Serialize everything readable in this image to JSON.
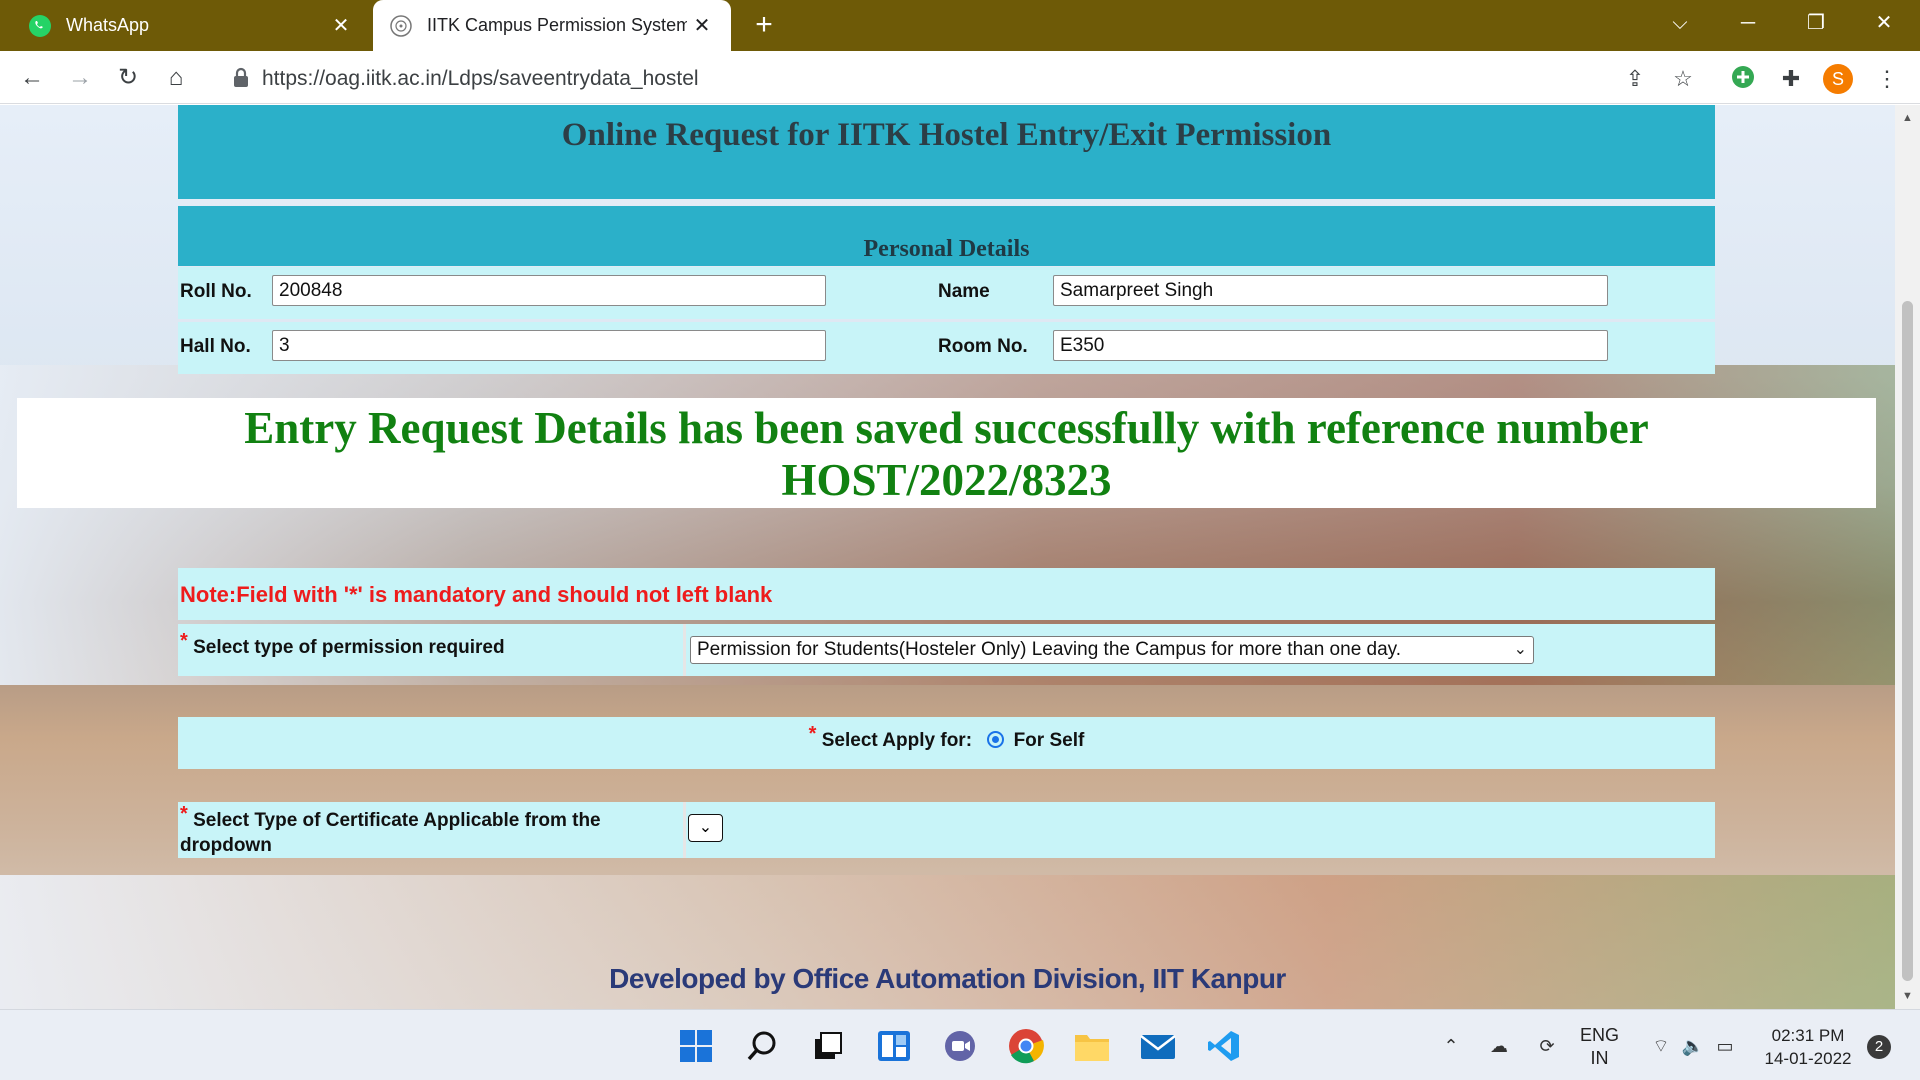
{
  "browser": {
    "tabs": [
      {
        "label": "WhatsApp",
        "icon": "whatsapp-icon",
        "active": false
      },
      {
        "label": "IITK Campus Permission System",
        "icon": "iitk-logo-icon",
        "active": true
      }
    ],
    "url": "https://oag.iitk.ac.in/Ldps/saveentrydata_hostel",
    "profile_initial": "S"
  },
  "page": {
    "title": "Online Request for IITK Hostel Entry/Exit Permission",
    "personal_details_title": "Personal Details",
    "fields": {
      "roll_label": "Roll No.",
      "roll_value": "200848",
      "name_label": "Name",
      "name_value": "Samarpreet Singh",
      "hall_label": "Hall No.",
      "hall_value": "3",
      "room_label": "Room No.",
      "room_value": "E350"
    },
    "success_line1": "Entry Request Details has been saved successfully with reference number",
    "success_line2": "HOST/2022/8323",
    "note": "Note:Field with '*' is mandatory and should not left blank",
    "required_mark": "*",
    "permission_label": "Select type of permission required",
    "permission_value": "Permission for Students(Hosteler Only) Leaving the Campus for more than one day.",
    "apply_for_label": "Select Apply for:",
    "apply_for_option": "For Self",
    "certificate_label": "Select Type of Certificate Applicable from the dropdown",
    "footer_credit": "Developed by Office Automation Division, IIT Kanpur"
  },
  "taskbar": {
    "lang_line1": "ENG",
    "lang_line2": "IN",
    "time": "02:31 PM",
    "date": "14-01-2022",
    "notification_count": "2"
  },
  "colors": {
    "header_band": "#2bb0c9",
    "row_bg": "#c8f4f8",
    "success_text": "#118111",
    "note_text": "#ee1c1c",
    "tab_strip": "#6e5a07"
  }
}
